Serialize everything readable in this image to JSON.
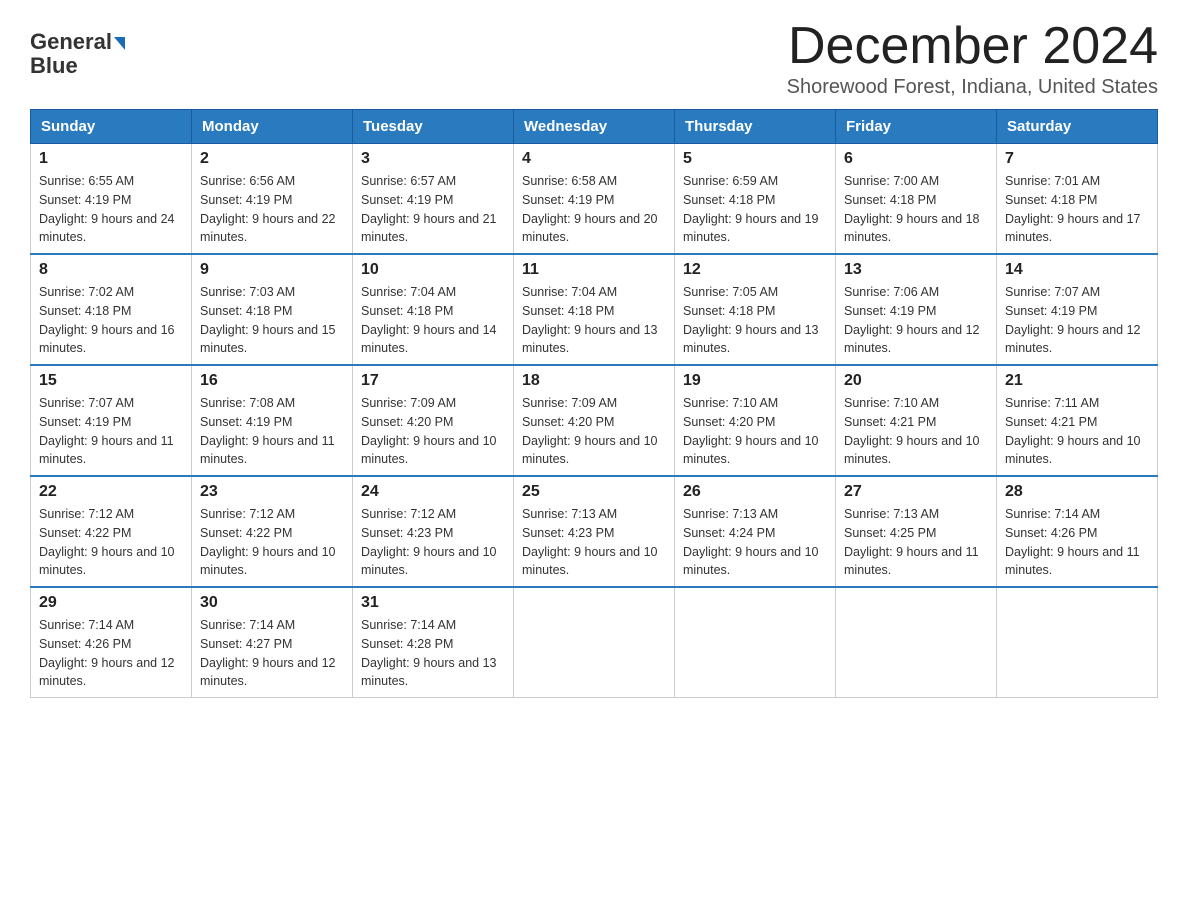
{
  "header": {
    "logo_line1": "General",
    "logo_line2": "Blue",
    "month_title": "December 2024",
    "location": "Shorewood Forest, Indiana, United States"
  },
  "weekdays": [
    "Sunday",
    "Monday",
    "Tuesday",
    "Wednesday",
    "Thursday",
    "Friday",
    "Saturday"
  ],
  "weeks": [
    [
      {
        "day": "1",
        "sunrise": "6:55 AM",
        "sunset": "4:19 PM",
        "daylight": "9 hours and 24 minutes."
      },
      {
        "day": "2",
        "sunrise": "6:56 AM",
        "sunset": "4:19 PM",
        "daylight": "9 hours and 22 minutes."
      },
      {
        "day": "3",
        "sunrise": "6:57 AM",
        "sunset": "4:19 PM",
        "daylight": "9 hours and 21 minutes."
      },
      {
        "day": "4",
        "sunrise": "6:58 AM",
        "sunset": "4:19 PM",
        "daylight": "9 hours and 20 minutes."
      },
      {
        "day": "5",
        "sunrise": "6:59 AM",
        "sunset": "4:18 PM",
        "daylight": "9 hours and 19 minutes."
      },
      {
        "day": "6",
        "sunrise": "7:00 AM",
        "sunset": "4:18 PM",
        "daylight": "9 hours and 18 minutes."
      },
      {
        "day": "7",
        "sunrise": "7:01 AM",
        "sunset": "4:18 PM",
        "daylight": "9 hours and 17 minutes."
      }
    ],
    [
      {
        "day": "8",
        "sunrise": "7:02 AM",
        "sunset": "4:18 PM",
        "daylight": "9 hours and 16 minutes."
      },
      {
        "day": "9",
        "sunrise": "7:03 AM",
        "sunset": "4:18 PM",
        "daylight": "9 hours and 15 minutes."
      },
      {
        "day": "10",
        "sunrise": "7:04 AM",
        "sunset": "4:18 PM",
        "daylight": "9 hours and 14 minutes."
      },
      {
        "day": "11",
        "sunrise": "7:04 AM",
        "sunset": "4:18 PM",
        "daylight": "9 hours and 13 minutes."
      },
      {
        "day": "12",
        "sunrise": "7:05 AM",
        "sunset": "4:18 PM",
        "daylight": "9 hours and 13 minutes."
      },
      {
        "day": "13",
        "sunrise": "7:06 AM",
        "sunset": "4:19 PM",
        "daylight": "9 hours and 12 minutes."
      },
      {
        "day": "14",
        "sunrise": "7:07 AM",
        "sunset": "4:19 PM",
        "daylight": "9 hours and 12 minutes."
      }
    ],
    [
      {
        "day": "15",
        "sunrise": "7:07 AM",
        "sunset": "4:19 PM",
        "daylight": "9 hours and 11 minutes."
      },
      {
        "day": "16",
        "sunrise": "7:08 AM",
        "sunset": "4:19 PM",
        "daylight": "9 hours and 11 minutes."
      },
      {
        "day": "17",
        "sunrise": "7:09 AM",
        "sunset": "4:20 PM",
        "daylight": "9 hours and 10 minutes."
      },
      {
        "day": "18",
        "sunrise": "7:09 AM",
        "sunset": "4:20 PM",
        "daylight": "9 hours and 10 minutes."
      },
      {
        "day": "19",
        "sunrise": "7:10 AM",
        "sunset": "4:20 PM",
        "daylight": "9 hours and 10 minutes."
      },
      {
        "day": "20",
        "sunrise": "7:10 AM",
        "sunset": "4:21 PM",
        "daylight": "9 hours and 10 minutes."
      },
      {
        "day": "21",
        "sunrise": "7:11 AM",
        "sunset": "4:21 PM",
        "daylight": "9 hours and 10 minutes."
      }
    ],
    [
      {
        "day": "22",
        "sunrise": "7:12 AM",
        "sunset": "4:22 PM",
        "daylight": "9 hours and 10 minutes."
      },
      {
        "day": "23",
        "sunrise": "7:12 AM",
        "sunset": "4:22 PM",
        "daylight": "9 hours and 10 minutes."
      },
      {
        "day": "24",
        "sunrise": "7:12 AM",
        "sunset": "4:23 PM",
        "daylight": "9 hours and 10 minutes."
      },
      {
        "day": "25",
        "sunrise": "7:13 AM",
        "sunset": "4:23 PM",
        "daylight": "9 hours and 10 minutes."
      },
      {
        "day": "26",
        "sunrise": "7:13 AM",
        "sunset": "4:24 PM",
        "daylight": "9 hours and 10 minutes."
      },
      {
        "day": "27",
        "sunrise": "7:13 AM",
        "sunset": "4:25 PM",
        "daylight": "9 hours and 11 minutes."
      },
      {
        "day": "28",
        "sunrise": "7:14 AM",
        "sunset": "4:26 PM",
        "daylight": "9 hours and 11 minutes."
      }
    ],
    [
      {
        "day": "29",
        "sunrise": "7:14 AM",
        "sunset": "4:26 PM",
        "daylight": "9 hours and 12 minutes."
      },
      {
        "day": "30",
        "sunrise": "7:14 AM",
        "sunset": "4:27 PM",
        "daylight": "9 hours and 12 minutes."
      },
      {
        "day": "31",
        "sunrise": "7:14 AM",
        "sunset": "4:28 PM",
        "daylight": "9 hours and 13 minutes."
      },
      null,
      null,
      null,
      null
    ]
  ]
}
